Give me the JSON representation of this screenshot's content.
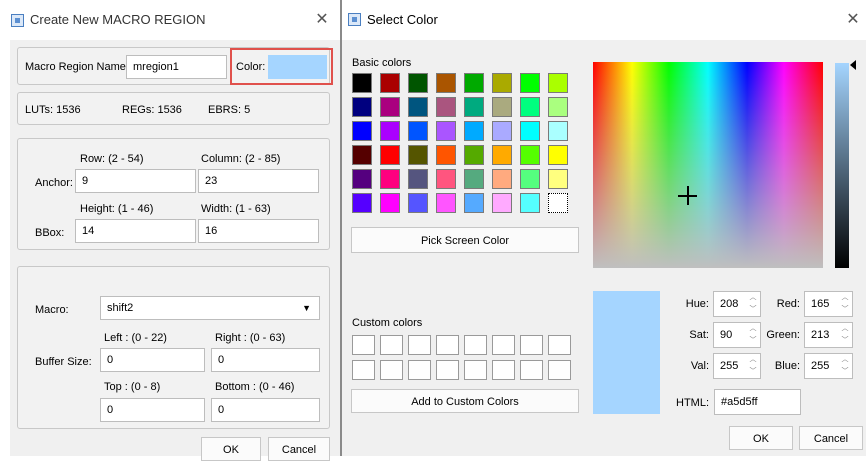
{
  "left_dialog": {
    "title": "Create New MACRO REGION",
    "macro_region_name_label": "Macro Region Name:",
    "macro_region_name_value": "mregion1",
    "color_label": "Color:",
    "color_value_hex": "#a5d5ff",
    "stats": {
      "luts": "LUTs: 1536",
      "regs": "REGs: 1536",
      "ebrs": "EBRS: 5"
    },
    "anchor": {
      "row_label": "Row: (2 - 54)",
      "column_label": "Column: (2 - 85)",
      "label": "Anchor:",
      "row_value": "9",
      "column_value": "23"
    },
    "bbox": {
      "height_label": "Height: (1 - 46)",
      "width_label": "Width: (1 - 63)",
      "label": "BBox:",
      "height_value": "14",
      "width_value": "16"
    },
    "macro_label": "Macro:",
    "macro_value": "shift2",
    "buffer": {
      "label": "Buffer Size:",
      "left_label": "Left : (0 - 22)",
      "right_label": "Right : (0 - 63)",
      "left_value": "0",
      "right_value": "0",
      "top_label": "Top : (0 - 8)",
      "bottom_label": "Bottom : (0 - 46)",
      "top_value": "0",
      "bottom_value": "0"
    },
    "ok_label": "OK",
    "cancel_label": "Cancel"
  },
  "color_dialog": {
    "title": "Select Color",
    "basic_colors_label": "Basic colors",
    "basic_colors": [
      [
        "#000000",
        "#aa0000",
        "#005500",
        "#aa5500",
        "#00aa00",
        "#aaaa00",
        "#00ff00",
        "#aaff00"
      ],
      [
        "#00007f",
        "#aa007f",
        "#00557f",
        "#aa557f",
        "#00aa7f",
        "#aaaa7f",
        "#00ff7f",
        "#aaff7f"
      ],
      [
        "#0000ff",
        "#aa00ff",
        "#0055ff",
        "#aa55ff",
        "#00aaff",
        "#aaaaff",
        "#00ffff",
        "#aaffff"
      ],
      [
        "#550000",
        "#ff0000",
        "#555500",
        "#ff5500",
        "#55aa00",
        "#ffaa00",
        "#55ff00",
        "#ffff00"
      ],
      [
        "#55007f",
        "#ff007f",
        "#55557f",
        "#ff557f",
        "#55aa7f",
        "#ffaa7f",
        "#55ff7f",
        "#ffff7f"
      ],
      [
        "#5500ff",
        "#ff00ff",
        "#5555ff",
        "#ff55ff",
        "#55aaff",
        "#ffaaff",
        "#55ffff",
        "#ffffff"
      ]
    ],
    "pick_screen_label": "Pick Screen Color",
    "custom_colors_label": "Custom colors",
    "add_custom_label": "Add to Custom Colors",
    "current_color_hex": "#a5d5ff",
    "hue_label": "Hue:",
    "hue_value": "208",
    "sat_label": "Sat:",
    "sat_value": "90",
    "val_label": "Val:",
    "val_value": "255",
    "red_label": "Red:",
    "red_value": "165",
    "green_label": "Green:",
    "green_value": "213",
    "blue_label": "Blue:",
    "blue_value": "255",
    "html_label": "HTML:",
    "html_value": "#a5d5ff",
    "ok_label": "OK",
    "cancel_label": "Cancel"
  }
}
